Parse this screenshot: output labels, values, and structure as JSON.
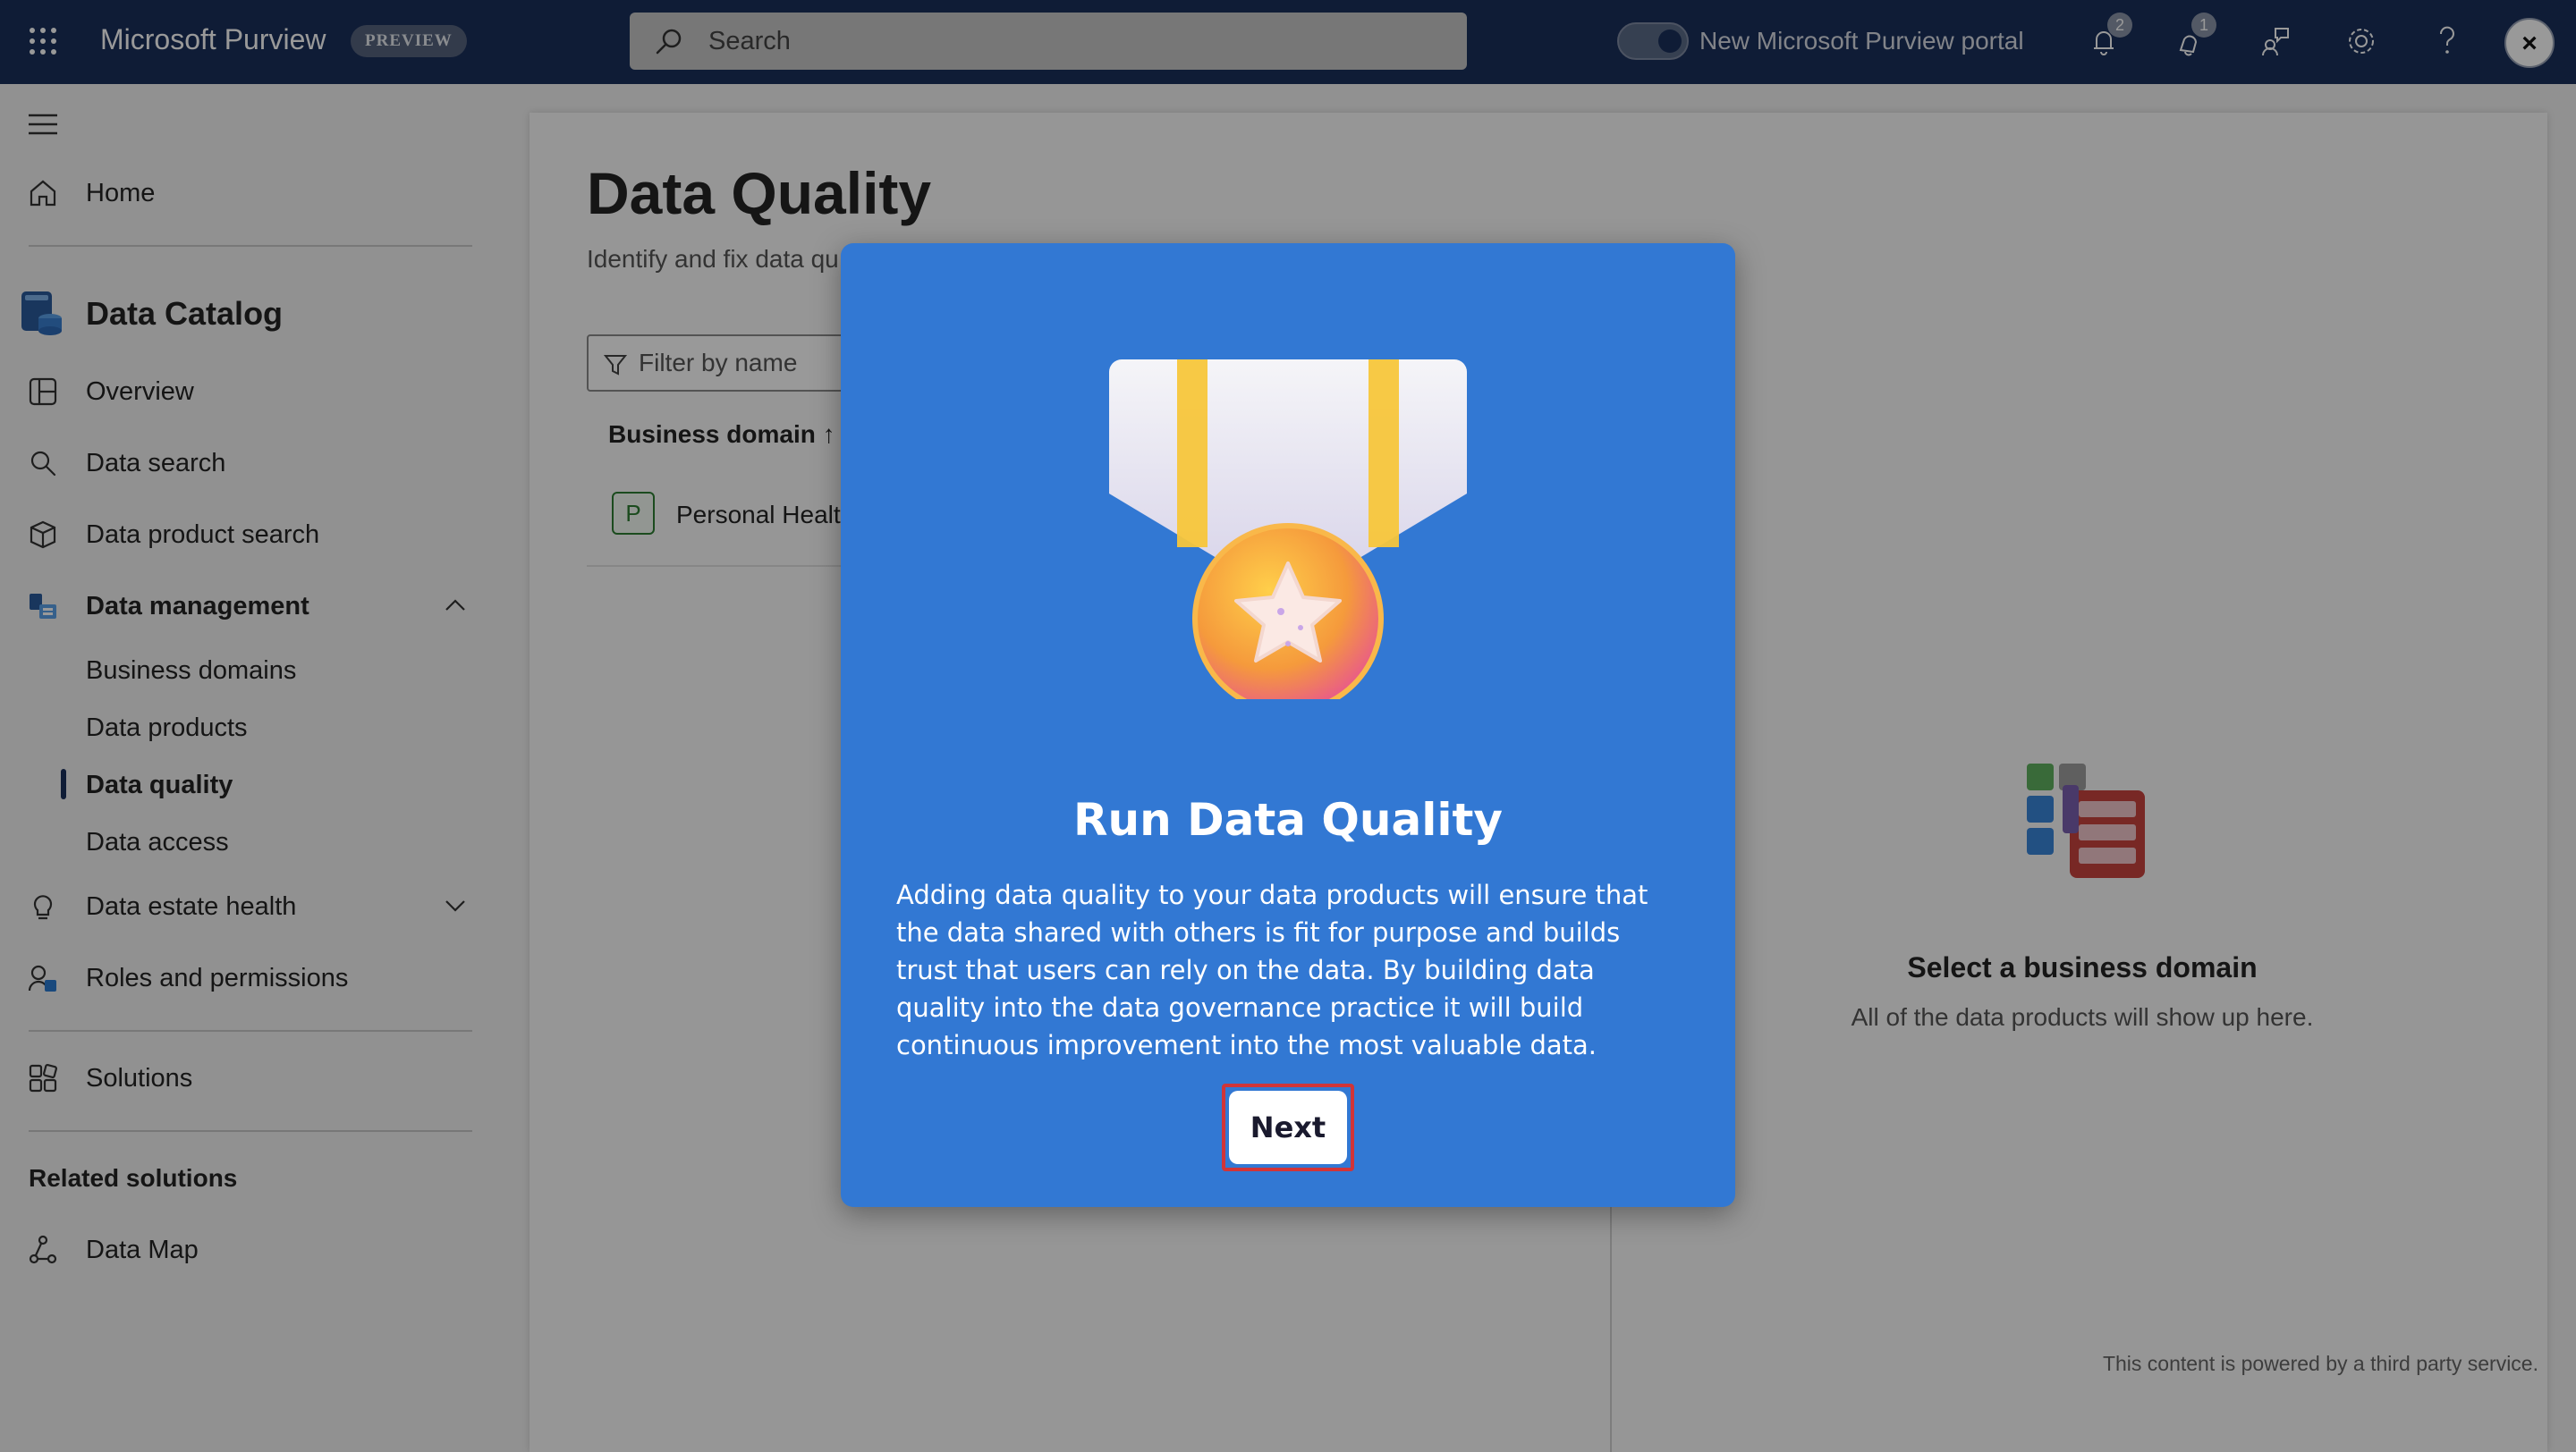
{
  "topbar": {
    "app_title": "Microsoft Purview",
    "preview_badge": "PREVIEW",
    "search_placeholder": "Search",
    "toggle_label": "New Microsoft Purview portal",
    "notifications_count": "2",
    "alerts_count": "1"
  },
  "sidebar": {
    "home": "Home",
    "catalog_title": "Data Catalog",
    "overview": "Overview",
    "data_search": "Data search",
    "data_product_search": "Data product search",
    "data_management": "Data management",
    "business_domains": "Business domains",
    "data_products": "Data products",
    "data_quality": "Data quality",
    "data_access": "Data access",
    "data_estate_health": "Data estate health",
    "roles_permissions": "Roles and permissions",
    "solutions": "Solutions",
    "related_title": "Related solutions",
    "data_map": "Data Map"
  },
  "main": {
    "title": "Data Quality",
    "subtitle": "Identify and fix data qu",
    "filter_placeholder": "Filter by name",
    "column_header": "Business domain ↑",
    "rows": [
      {
        "chip": "P",
        "name": "Personal Health"
      }
    ],
    "empty_title": "Select a business domain",
    "empty_subtitle": "All of the data products will show up here.",
    "powered_by": "This content is powered by a third party service."
  },
  "modal": {
    "title": "Run Data Quality",
    "body": "Adding data quality to your data products will ensure that the data shared with others is fit for purpose and builds trust that users can rely on the data. By building data quality into the data governance practice it will build continuous improvement into the most valuable data.",
    "next_label": "Next"
  },
  "colors": {
    "topbar": "#1a2f5b",
    "modal": "#3278d3",
    "highlight": "#d13438"
  }
}
